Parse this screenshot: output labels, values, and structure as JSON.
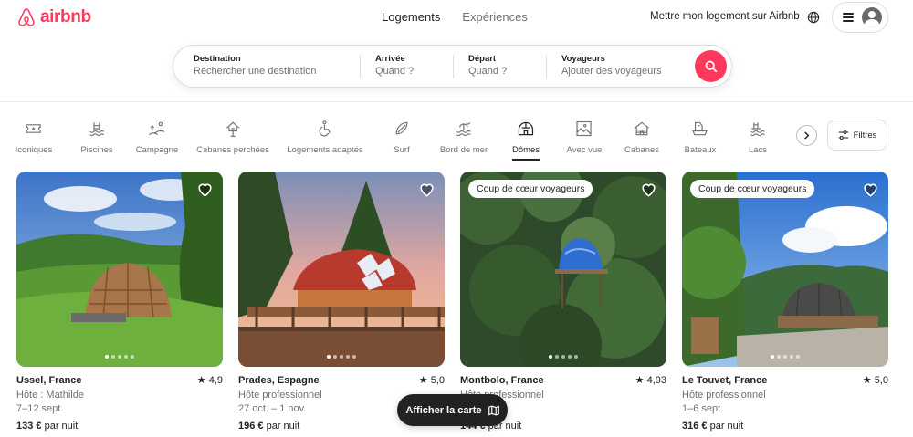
{
  "brand": {
    "name": "airbnb",
    "color": "#ff385c"
  },
  "nav": {
    "tabs": [
      {
        "label": "Logements",
        "active": true
      },
      {
        "label": "Expériences",
        "active": false
      }
    ]
  },
  "header": {
    "host_link": "Mettre mon logement sur Airbnb",
    "globe_icon": "globe-icon",
    "menu_icon": "hamburger-icon",
    "avatar_icon": "user-avatar-icon"
  },
  "search": {
    "destination": {
      "label": "Destination",
      "placeholder": "Rechercher une destination"
    },
    "arrival": {
      "label": "Arrivée",
      "placeholder": "Quand ?"
    },
    "departure": {
      "label": "Départ",
      "placeholder": "Quand ?"
    },
    "travelers": {
      "label": "Voyageurs",
      "placeholder": "Ajouter des voyageurs"
    },
    "button_icon": "search-icon"
  },
  "categories": [
    {
      "label": "Iconiques",
      "icon": "ticket-icon"
    },
    {
      "label": "Piscines",
      "icon": "pool-icon"
    },
    {
      "label": "Campagne",
      "icon": "countryside-icon"
    },
    {
      "label": "Cabanes perchées",
      "icon": "treehouse-icon"
    },
    {
      "label": "Logements adaptés",
      "icon": "accessible-icon"
    },
    {
      "label": "Surf",
      "icon": "surfboard-icon"
    },
    {
      "label": "Bord de mer",
      "icon": "beachfront-icon"
    },
    {
      "label": "Dômes",
      "icon": "dome-icon",
      "active": true
    },
    {
      "label": "Avec vue",
      "icon": "view-icon"
    },
    {
      "label": "Cabanes",
      "icon": "cabin-icon"
    },
    {
      "label": "Bateaux",
      "icon": "boat-icon"
    },
    {
      "label": "Lacs",
      "icon": "lake-icon"
    }
  ],
  "filters": {
    "label": "Filtres",
    "icon": "sliders-icon"
  },
  "listings": [
    {
      "location": "Ussel, France",
      "rating": "4,9",
      "host": "Hôte : Mathilde",
      "dates": "7–12 sept.",
      "price": "133 €",
      "price_suffix": "par nuit",
      "badge": ""
    },
    {
      "location": "Prades, Espagne",
      "rating": "5,0",
      "host": "Hôte professionnel",
      "dates": "27 oct. – 1 nov.",
      "price": "196 €",
      "price_suffix": "par nuit",
      "badge": ""
    },
    {
      "location": "Montbolo, France",
      "rating": "4,93",
      "host": "Hôte professionnel",
      "dates": "",
      "price": "144 €",
      "price_suffix": "par nuit",
      "badge": "Coup de cœur voyageurs"
    },
    {
      "location": "Le Touvet, France",
      "rating": "5,0",
      "host": "Hôte professionnel",
      "dates": "1–6 sept.",
      "price": "316 €",
      "price_suffix": "par nuit",
      "badge": "Coup de cœur voyageurs"
    }
  ],
  "map_button": {
    "label": "Afficher la carte",
    "icon": "map-icon"
  }
}
